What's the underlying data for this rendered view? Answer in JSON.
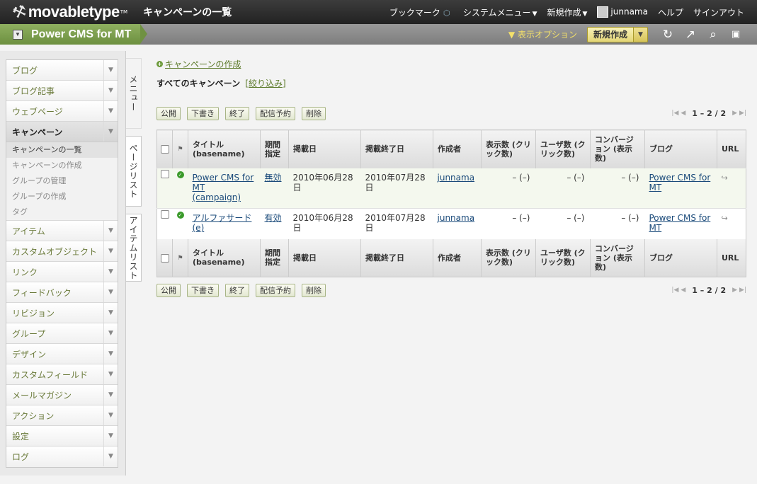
{
  "app": {
    "logo_text": "movabletype",
    "logo_tm": "TM",
    "page_title": "キャンペーンの一覧"
  },
  "topnav": {
    "bookmark": "ブックマーク",
    "system_menu": "システムメニュー",
    "new": "新規作成",
    "user": "junnama",
    "help": "ヘルプ",
    "signout": "サインアウト"
  },
  "blogbar": {
    "blog_name": "Power CMS for MT",
    "display_options": "表示オプション",
    "new_button": "新規作成"
  },
  "sidebar": {
    "items": [
      {
        "label": "ブログ"
      },
      {
        "label": "ブログ記事"
      },
      {
        "label": "ウェブページ"
      },
      {
        "label": "キャンペーン"
      },
      {
        "label": "アイテム"
      },
      {
        "label": "カスタムオブジェクト"
      },
      {
        "label": "リンク"
      },
      {
        "label": "フィードバック"
      },
      {
        "label": "リビジョン"
      },
      {
        "label": "グループ"
      },
      {
        "label": "デザイン"
      },
      {
        "label": "カスタムフィールド"
      },
      {
        "label": "メールマガジン"
      },
      {
        "label": "アクション"
      },
      {
        "label": "設定"
      },
      {
        "label": "ログ"
      }
    ],
    "submenu": [
      "キャンペーンの一覧",
      "キャンペーンの作成",
      "グループの管理",
      "グループの作成",
      "タグ"
    ]
  },
  "vtabs": {
    "menu": "メニュー",
    "page_list": "ページリスト",
    "item_list": "アイテムリスト"
  },
  "content": {
    "create_link": "キャンペーンの作成",
    "list_title": "すべてのキャンペーン",
    "filter_link": "[絞り込み]",
    "actions": {
      "publish": "公開",
      "draft": "下書き",
      "end": "終了",
      "schedule": "配信予約",
      "delete": "削除"
    },
    "pager": "1 – 2 / 2",
    "columns": {
      "title": "タイトル (basename)",
      "period": "期間指定",
      "start": "掲載日",
      "end": "掲載終了日",
      "author": "作成者",
      "views": "表示数 (クリック数)",
      "users": "ユーザ数 (クリック数)",
      "conversion": "コンバージョン (表示数)",
      "blog": "ブログ",
      "url": "URL"
    },
    "rows": [
      {
        "title": "Power CMS for MT (campaign)",
        "period": "無効",
        "start": "2010年06月28日",
        "end": "2010年07月28日",
        "author": "junnama",
        "views": "– (–)",
        "users": "– (–)",
        "conversion": "– (–)",
        "blog": "Power CMS for MT"
      },
      {
        "title": "アルファサード (e)",
        "period": "有効",
        "start": "2010年06月28日",
        "end": "2010年07月28日",
        "author": "junnama",
        "views": "– (–)",
        "users": "– (–)",
        "conversion": "– (–)",
        "blog": "Power CMS for MT"
      }
    ]
  },
  "colors": {
    "accent_green": "#6c8f3f",
    "topbar": "#2e2e2e",
    "button_yellow": "#ece08a"
  }
}
